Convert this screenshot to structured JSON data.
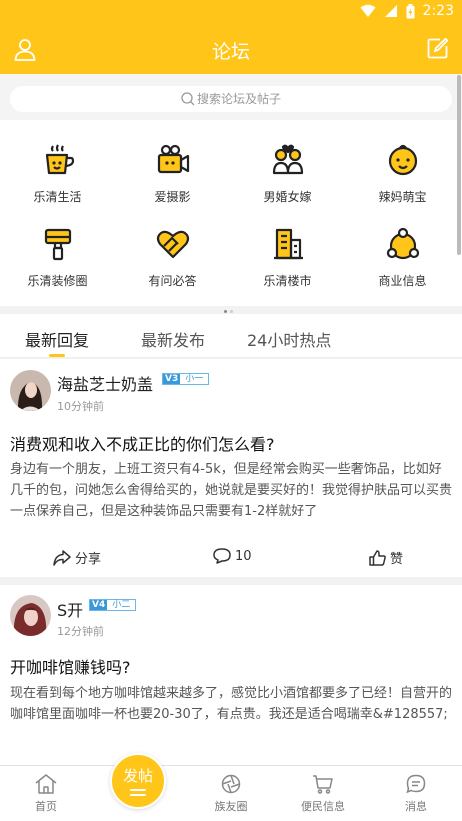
{
  "status": {
    "time": "2:23"
  },
  "header": {
    "title": "论坛",
    "left_icon": "user-icon",
    "right_icon": "edit-icon"
  },
  "search": {
    "placeholder": "搜索论坛及帖子"
  },
  "categories": [
    {
      "label": "乐清生活",
      "icon": "coffee-cup-icon"
    },
    {
      "label": "爱摄影",
      "icon": "video-camera-icon"
    },
    {
      "label": "男婚女嫁",
      "icon": "couple-icon"
    },
    {
      "label": "辣妈萌宝",
      "icon": "baby-icon"
    },
    {
      "label": "乐清装修圈",
      "icon": "paint-brush-icon"
    },
    {
      "label": "有问必答",
      "icon": "heart-handshake-icon"
    },
    {
      "label": "乐清楼市",
      "icon": "building-icon"
    },
    {
      "label": "商业信息",
      "icon": "business-network-icon"
    }
  ],
  "tabs": [
    {
      "label": "最新回复",
      "active": true
    },
    {
      "label": "最新发布",
      "active": false
    },
    {
      "label": "24小时热点",
      "active": false
    }
  ],
  "posts": [
    {
      "author": "海盐芝士奶盖",
      "badge_v": "V3",
      "badge_text": "小一",
      "time": "10分钟前",
      "title": "消费观和收入不成正比的你们怎么看?",
      "body": "身边有一个朋友，上班工资只有4-5k，但是经常会购买一些奢饰品，比如好几千的包，问她怎么舍得给买的，她说就是要买好的！我觉得护肤品可以买贵一点保养自己，但是这种装饰品只需要有1-2样就好了",
      "share_label": "分享",
      "comments": "10",
      "like_label": "赞"
    },
    {
      "author": "S开",
      "badge_v": "V4",
      "badge_text": "小二",
      "time": "12分钟前",
      "title": "开咖啡馆赚钱吗?",
      "body": "现在看到每个地方咖啡馆越来越多了，感觉比小酒馆都要多了已经！自营开的咖啡馆里面咖啡一杯也要20-30了，有点贵。我还是适合喝瑞幸&#128557;"
    }
  ],
  "bottom_nav": [
    {
      "label": "首页",
      "icon": "home-icon"
    },
    {
      "label": "发帖",
      "icon": "post-icon"
    },
    {
      "label": "族友圈",
      "icon": "aperture-icon"
    },
    {
      "label": "便民信息",
      "icon": "cart-icon"
    },
    {
      "label": "消息",
      "icon": "message-icon"
    }
  ],
  "colors": {
    "accent": "#ffc619",
    "badge": "#3a9ad9"
  }
}
